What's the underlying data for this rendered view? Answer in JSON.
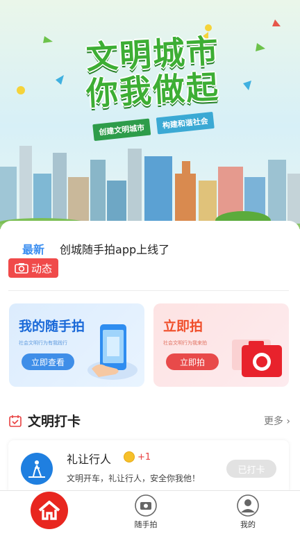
{
  "hero": {
    "title_line1": "文明城市",
    "title_line2": "你我做起",
    "ribbon_left": "创建文明城市",
    "ribbon_right": "构建和谐社会"
  },
  "news": {
    "tag": "最新",
    "text": "创城随手拍app上线了",
    "dynamic_label": "动态"
  },
  "tiles": [
    {
      "title": "我的随手拍",
      "subtitle": "社会文明行为有我践行",
      "button": "立即查看"
    },
    {
      "title": "立即拍",
      "subtitle": "社会文明行为我来拍",
      "button": "立即拍"
    }
  ],
  "section": {
    "title": "文明打卡",
    "more": "更多"
  },
  "checkin": {
    "name": "礼让行人",
    "points": "+1",
    "desc": "文明开车，礼让行人，安全你我他！",
    "button": "已打卡"
  },
  "tabbar": {
    "tab2": "随手拍",
    "tab3": "我的"
  },
  "colors": {
    "accent_blue": "#1a69d8",
    "accent_red": "#e8261f",
    "hero_green": "#3dae34"
  }
}
